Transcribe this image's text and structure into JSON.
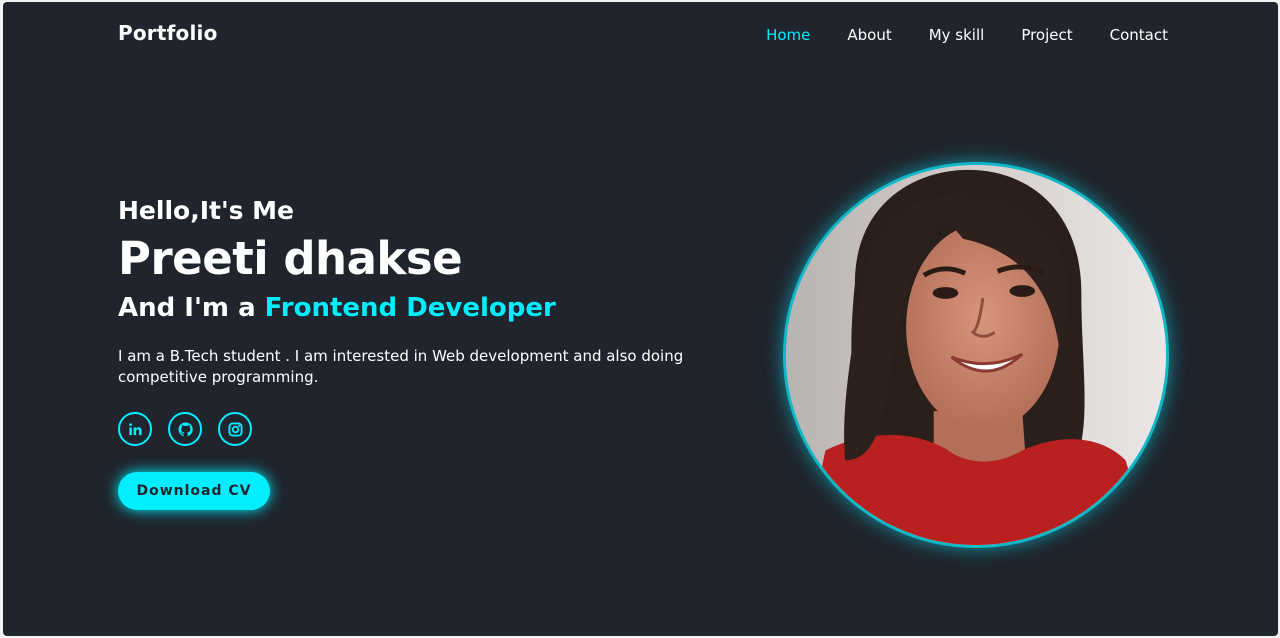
{
  "header": {
    "logo": "Portfolio",
    "nav": [
      {
        "label": "Home",
        "active": true
      },
      {
        "label": "About",
        "active": false
      },
      {
        "label": "My skill",
        "active": false
      },
      {
        "label": "Project",
        "active": false
      },
      {
        "label": "Contact",
        "active": false
      }
    ]
  },
  "hero": {
    "greeting": "Hello,It's Me",
    "name": "Preeti dhakse",
    "role_prefix": "And I'm a ",
    "role_highlight": "Frontend Developer",
    "description": "I am a B.Tech student . I am interested in Web development and also doing competitive programming.",
    "socials": [
      {
        "icon": "linkedin-icon"
      },
      {
        "icon": "github-icon"
      },
      {
        "icon": "instagram-icon"
      }
    ],
    "cta_label": "Download CV"
  },
  "colors": {
    "background": "#1f242d",
    "accent": "#00eeff",
    "text": "#ffffff"
  }
}
